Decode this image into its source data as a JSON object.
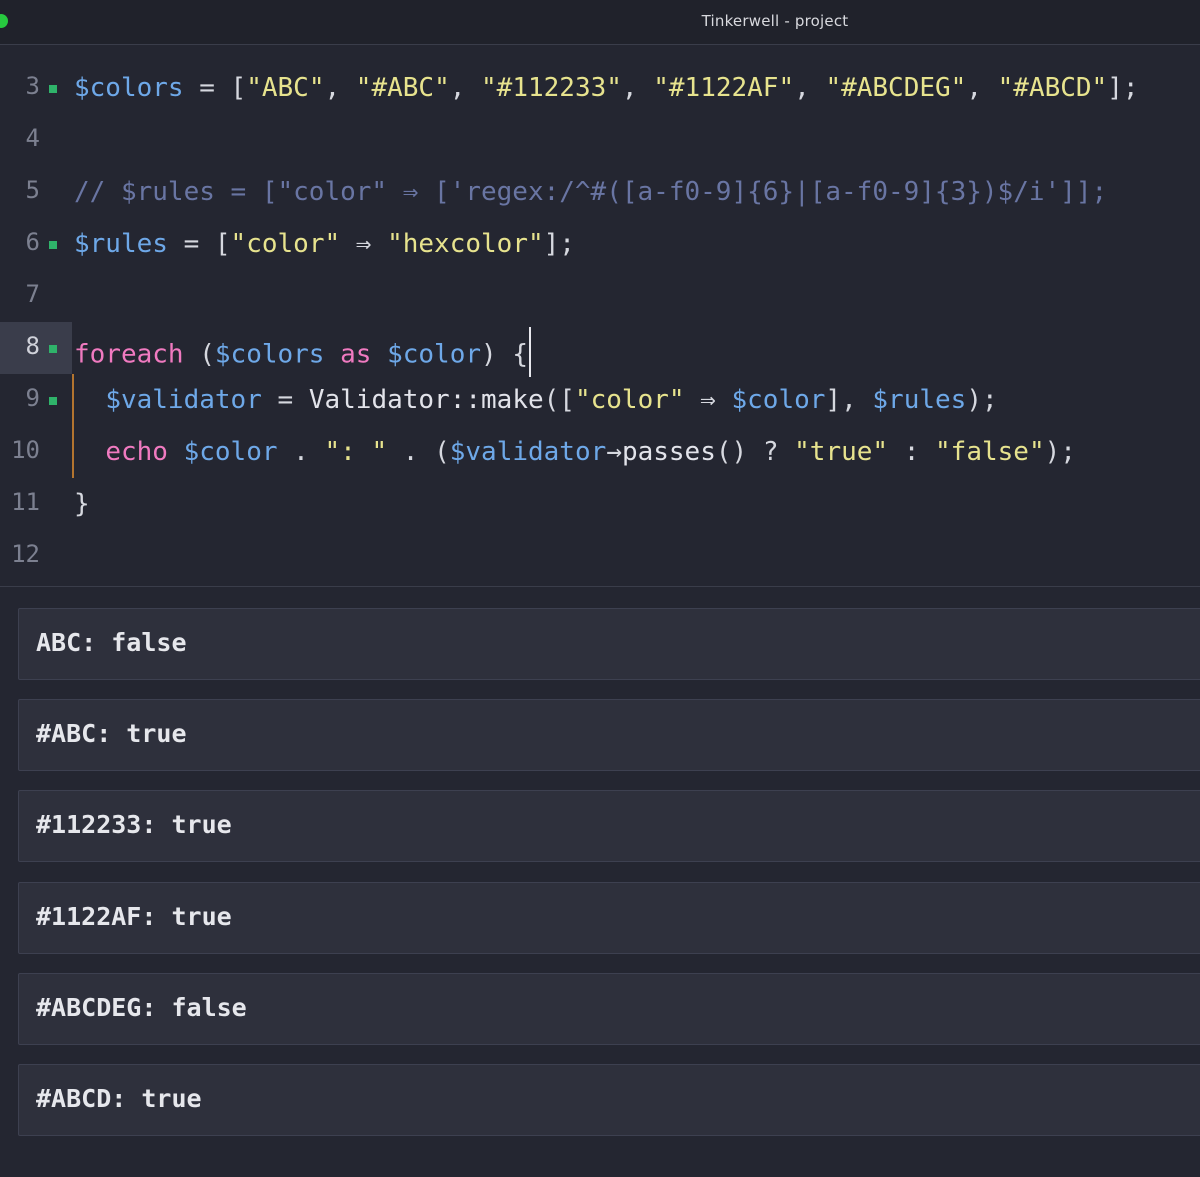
{
  "window": {
    "title": "Tinkerwell - project"
  },
  "editor": {
    "lines": [
      {
        "number": "3"
      },
      {
        "number": "4"
      },
      {
        "number": "5"
      },
      {
        "number": "6"
      },
      {
        "number": "7"
      },
      {
        "number": "8"
      },
      {
        "number": "9"
      },
      {
        "number": "10"
      },
      {
        "number": "11"
      },
      {
        "number": "12"
      }
    ],
    "code": {
      "l3": {
        "var_colors": "$colors",
        "assign": " = [",
        "s1": "\"ABC\"",
        "sep1": ", ",
        "s2": "\"#ABC\"",
        "sep2": ", ",
        "s3": "\"#112233\"",
        "sep3": ", ",
        "s4": "\"#1122AF\"",
        "sep4": ", ",
        "s5": "\"#ABCDEG\"",
        "sep5": ", ",
        "s6": "\"#ABCD\"",
        "end": "];"
      },
      "l5": {
        "comment": "// $rules = [\"color\" ⇒ ['regex:/^#([a-f0-9]{6}|[a-f0-9]{3})$/i']];"
      },
      "l6": {
        "var_rules": "$rules",
        "assign": " = [",
        "key": "\"color\"",
        "arrow": " ⇒ ",
        "value": "\"hexcolor\"",
        "end": "];"
      },
      "l8": {
        "kw_foreach": "foreach",
        "open": " (",
        "var_colors": "$colors",
        "kw_as": " as ",
        "var_color": "$color",
        "close": ") {"
      },
      "l9": {
        "indent": "  ",
        "var_validator": "$validator",
        "assign": " = ",
        "fn": "Validator::make",
        "open": "([",
        "key": "\"color\"",
        "arrow": " ⇒ ",
        "var_color": "$color",
        "mid": "], ",
        "var_rules": "$rules",
        "end": ");"
      },
      "l10": {
        "indent": "  ",
        "kw_echo": "echo",
        "sp": " ",
        "var_color": "$color",
        "dot1": " . ",
        "s_colon": "\": \"",
        "dot2": " . (",
        "var_validator": "$validator",
        "arrow": "→",
        "fn": "passes",
        "tern": "() ? ",
        "s_true": "\"true\"",
        "colon": " : ",
        "s_false": "\"false\"",
        "end": ");"
      },
      "l11": {
        "brace": "}"
      }
    }
  },
  "output": {
    "results": [
      "ABC: false",
      "#ABC: true",
      "#112233: true",
      "#1122AF: true",
      "#ABCDEG: false",
      "#ABCD: true"
    ]
  },
  "colors": {
    "background": "#242631",
    "variable": "#6ea8e8",
    "string": "#e7e38e",
    "keyword": "#f07ac0",
    "comment": "#6975a3",
    "fold_marker": "#2fb36a",
    "indent_guide": "#b3742f"
  }
}
